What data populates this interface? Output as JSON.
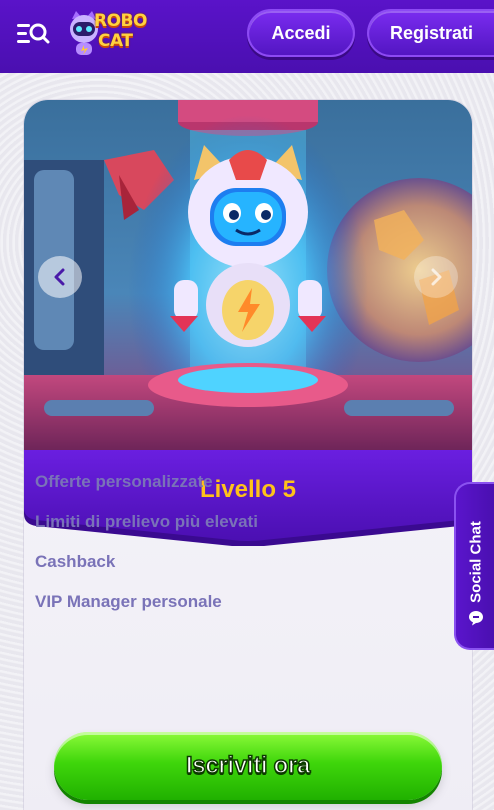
{
  "header": {
    "logo_text_line1": "ROBO",
    "logo_text_line2": "CAT",
    "login_label": "Accedi",
    "register_label": "Registrati"
  },
  "promo": {
    "level_title": "Livello 5",
    "features": [
      "Offerte personalizzate",
      "Limiti di prelievo più elevati",
      "Cashback",
      "VIP Manager personale"
    ],
    "cta_label": "Iscriviti ora"
  },
  "social_chat": {
    "label": "Social Chat"
  },
  "icons": {
    "menu": "menu-search-icon",
    "prev": "chevron-left-icon",
    "next": "chevron-right-icon",
    "chat": "chat-bubble-icon"
  },
  "colors": {
    "header_bg": "#4a0fb0",
    "level_banner_bg": "#5a16cf",
    "level_title": "#ffc21a",
    "feature_text": "#7a73b8",
    "cta_green": "#3fd60b"
  }
}
